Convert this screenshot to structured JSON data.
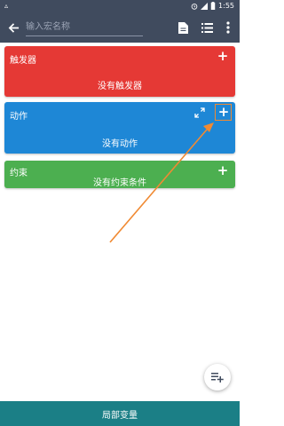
{
  "status_bar": {
    "time": "1:55",
    "icons": [
      "notification-bell-icon",
      "alarm-icon",
      "signal-icon",
      "battery-icon"
    ]
  },
  "app_bar": {
    "name_placeholder": "输入宏名称",
    "icons": [
      "back-arrow-icon",
      "document-icon",
      "list-icon",
      "more-vert-icon"
    ]
  },
  "cards": {
    "trigger": {
      "title": "触发器",
      "empty_text": "没有触发器",
      "add": "+",
      "color": "#e53935"
    },
    "action": {
      "title": "动作",
      "empty_text": "没有动作",
      "add": "+",
      "color": "#1e87d6"
    },
    "constraint": {
      "title": "约束",
      "empty_text": "没有约束条件",
      "add": "+",
      "color": "#4caf50"
    }
  },
  "annotation": {
    "arrow_color": "#f08a33"
  },
  "bottom_bar": {
    "label": "局部变量",
    "color": "#1b7f86"
  }
}
